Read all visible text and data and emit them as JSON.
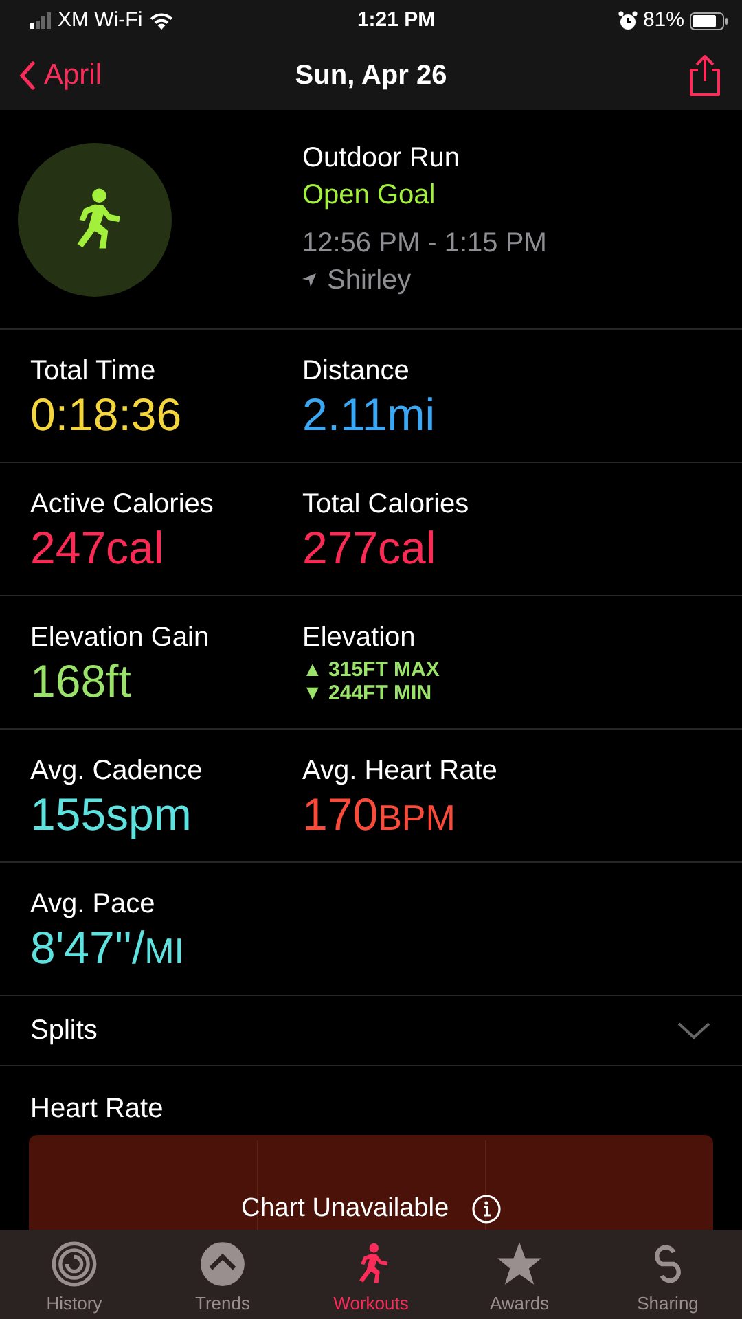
{
  "status_bar": {
    "carrier": "XM Wi-Fi",
    "time": "1:21 PM",
    "battery": "81%"
  },
  "nav": {
    "back": "April",
    "title": "Sun, Apr 26"
  },
  "workout": {
    "type": "Outdoor Run",
    "goal": "Open Goal",
    "time_range": "12:56 PM - 1:15 PM",
    "location": "Shirley"
  },
  "metrics": [
    {
      "label": "Total Time",
      "value": "0:18:36",
      "color": "#f5d53c"
    },
    {
      "label": "Distance",
      "value": "2.11mi",
      "color": "#3aa8f5"
    },
    {
      "label": "Active Calories",
      "value": "247cal",
      "color": "#fa2a55"
    },
    {
      "label": "Total Calories",
      "value": "277cal",
      "color": "#fa2a55"
    },
    {
      "label": "Elevation Gain",
      "value": "168ft",
      "color": "#9be26b"
    },
    {
      "label": "Elevation",
      "lines": [
        {
          "arrow": "▲",
          "text": "315FT MAX"
        },
        {
          "arrow": "▼",
          "text": "244FT MIN"
        }
      ],
      "color": "#9be26b"
    },
    {
      "label": "Avg. Cadence",
      "value": "155spm",
      "color": "#5de2e0"
    },
    {
      "label": "Avg. Heart Rate",
      "value": "170",
      "unit": "BPM",
      "color": "#fa4b3a"
    },
    {
      "label": "Avg. Pace",
      "value": "8'47''/",
      "unit": "MI",
      "color": "#5de2e0"
    }
  ],
  "splits": {
    "label": "Splits",
    "expanded": false
  },
  "heart_rate": {
    "label": "Heart Rate",
    "message": "Chart Unavailable"
  },
  "tabs": [
    {
      "label": "History",
      "selected": false
    },
    {
      "label": "Trends",
      "selected": false
    },
    {
      "label": "Workouts",
      "selected": true
    },
    {
      "label": "Awards",
      "selected": false
    },
    {
      "label": "Sharing",
      "selected": false
    }
  ]
}
